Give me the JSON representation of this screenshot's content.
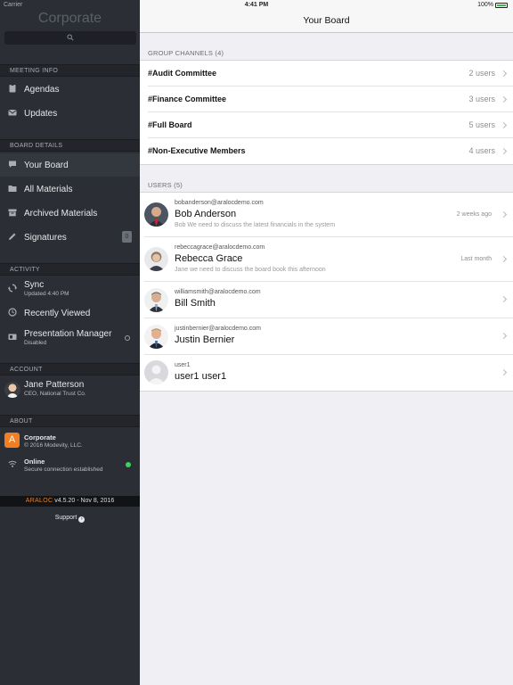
{
  "status_bar": {
    "carrier": "Carrier",
    "time": "4:41 PM",
    "battery": "100%"
  },
  "sidebar": {
    "app_title": "Corporate",
    "sections": {
      "meeting_info": "MEETING INFO",
      "board_details": "BOARD DETAILS",
      "activity": "ACTIVITY",
      "account": "ACCOUNT",
      "about": "ABOUT"
    },
    "items": {
      "agendas": "Agendas",
      "updates": "Updates",
      "your_board": "Your Board",
      "all_materials": "All Materials",
      "archived_materials": "Archived Materials",
      "signatures": "Signatures",
      "sync": "Sync",
      "sync_sub": "Updated 4:40 PM",
      "recently_viewed": "Recently Viewed",
      "presentation_manager": "Presentation Manager",
      "presentation_manager_sub": "Disabled"
    },
    "signature_badge": "0",
    "account": {
      "name": "Jane Patterson",
      "role": "CEO, National Trust Co."
    },
    "about": {
      "app_name": "Corporate",
      "copyright": "© 2016 Modevity, LLC.",
      "logo_letter": "A",
      "online": "Online",
      "online_sub": "Secure connection established"
    },
    "version": {
      "brand": "ARALOC",
      "text": " v4.5.20 - Nov 8, 2016"
    },
    "support": "Support"
  },
  "main": {
    "title": "Your Board",
    "group_channels_header": "GROUP CHANNELS (4)",
    "channels": [
      {
        "name": "#Audit Committee",
        "count": "2 users"
      },
      {
        "name": "#Finance Committee",
        "count": "3 users"
      },
      {
        "name": "#Full Board",
        "count": "5 users"
      },
      {
        "name": "#Non-Executive Members",
        "count": "4 users"
      }
    ],
    "users_header": "USERS (5)",
    "users": [
      {
        "email": "bobanderson@aralocdemo.com",
        "name": "Bob Anderson",
        "message": "Bob We need to discuss the latest financials in the system",
        "when": "2 weeks ago"
      },
      {
        "email": "rebeccagrace@aralocdemo.com",
        "name": "Rebecca Grace",
        "message": "Jane we need to discuss the board book this afternoon",
        "when": "Last month"
      },
      {
        "email": "williamsmith@aralocdemo.com",
        "name": "Bill Smith",
        "message": "",
        "when": ""
      },
      {
        "email": "justinbernier@aralocdemo.com",
        "name": "Justin Bernier",
        "message": "",
        "when": ""
      },
      {
        "email": "user1",
        "name": "user1 user1",
        "message": "",
        "when": ""
      }
    ]
  }
}
